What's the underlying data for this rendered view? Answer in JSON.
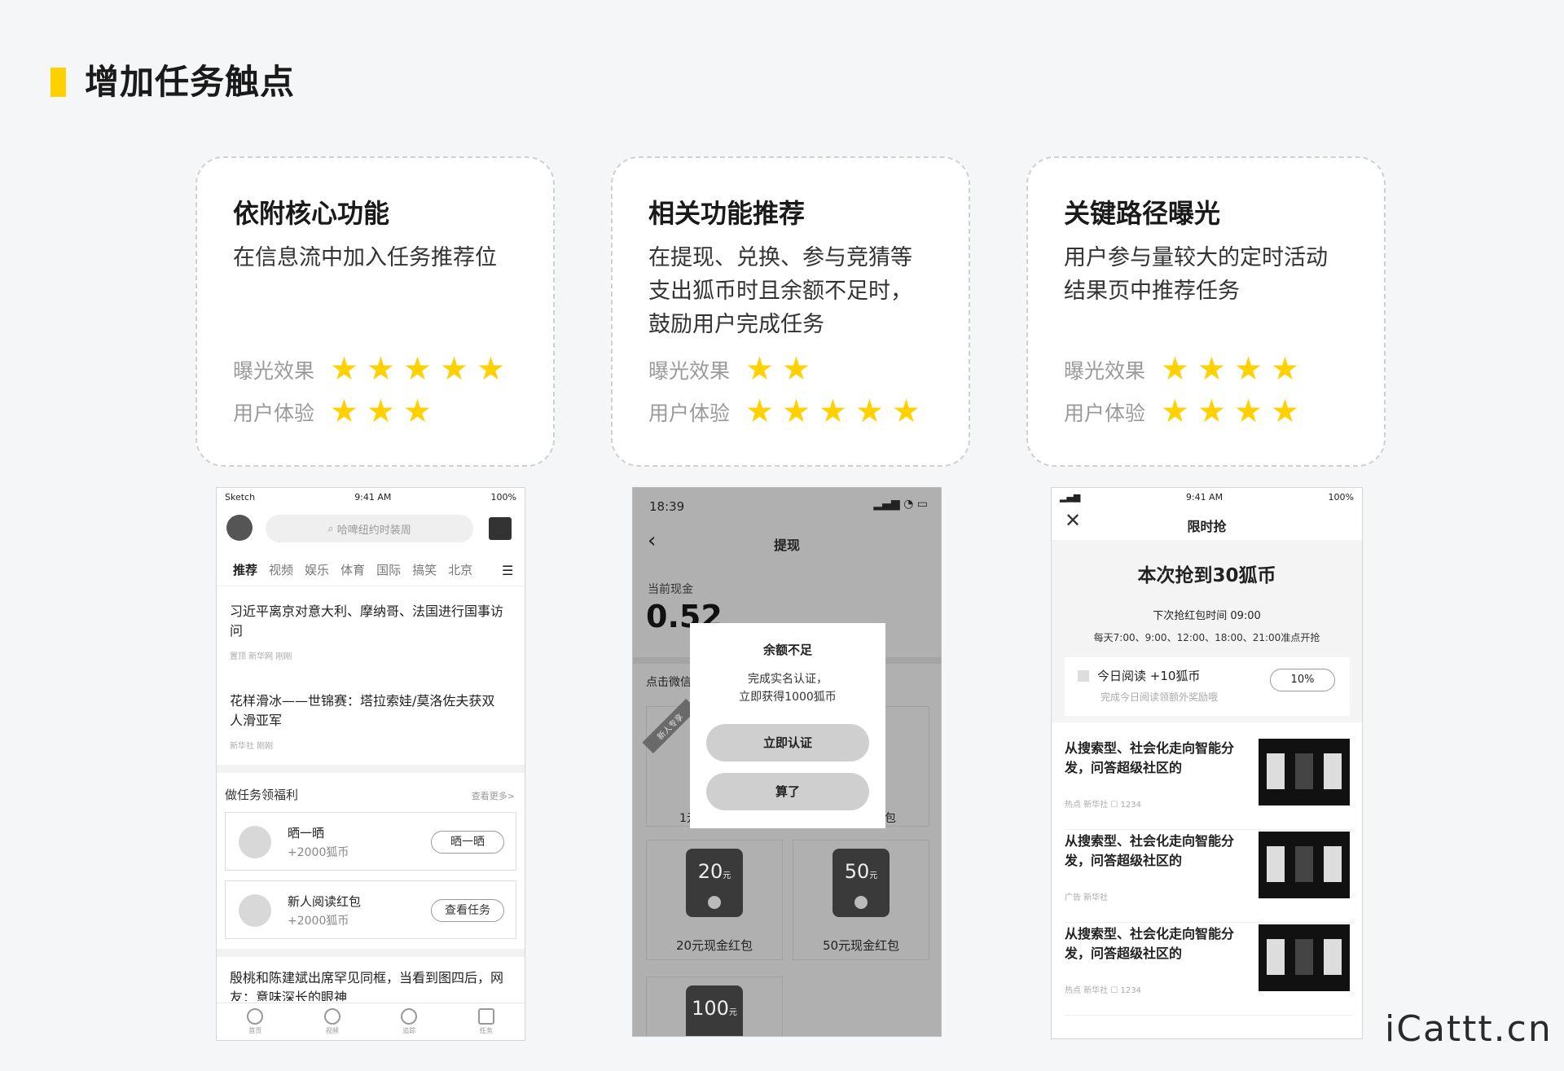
{
  "page": {
    "title": "增加任务触点",
    "watermark": "iCattt.cn"
  },
  "cards": [
    {
      "title": "依附核心功能",
      "desc": "在信息流中加入任务推荐位",
      "exposure_label": "曝光效果",
      "exposure_stars": 5,
      "ux_label": "用户体验",
      "ux_stars": 3
    },
    {
      "title": "相关功能推荐",
      "desc": "在提现、兑换、参与竞猜等\n支出狐币时且余额不足时，\n鼓励用户完成任务",
      "exposure_label": "曝光效果",
      "exposure_stars": 2,
      "ux_label": "用户体验",
      "ux_stars": 5
    },
    {
      "title": "关键路径曝光",
      "desc": "用户参与量较大的定时活动\n结果页中推荐任务",
      "exposure_label": "曝光效果",
      "exposure_stars": 4,
      "ux_label": "用户体验",
      "ux_stars": 4
    }
  ],
  "star_color": "#ffd100",
  "phone1": {
    "status": {
      "carrier": "Sketch",
      "time": "9:41 AM",
      "battery": "100%"
    },
    "search_placeholder": "哈啤纽约时装周",
    "nav": [
      "推荐",
      "视频",
      "娱乐",
      "体育",
      "国际",
      "搞笑",
      "北京"
    ],
    "news": [
      {
        "title": "习近平离京对意大利、摩纳哥、法国进行国事访问",
        "meta": "置顶  新华网  刚刚"
      },
      {
        "title": "花样滑冰——世锦赛：塔拉索娃/莫洛佐夫获双人滑亚军",
        "meta": "新华社  刚刚"
      }
    ],
    "task_section": {
      "title": "做任务领福利",
      "more": "查看更多>"
    },
    "tasks": [
      {
        "name": "晒一晒",
        "reward": "+2000狐币",
        "button": "晒一晒"
      },
      {
        "name": "新人阅读红包",
        "reward": "+2000狐币",
        "button": "查看任务"
      }
    ],
    "bottom_news": "殷桃和陈建斌出席罕见同框，当看到图四后，网友：意味深长的眼神",
    "tabs": [
      "首页",
      "视频",
      "追踪",
      "任务"
    ]
  },
  "phone2": {
    "status": {
      "time": "18:39"
    },
    "nav_title": "提现",
    "balance_label": "当前现金",
    "balance": "0.52",
    "section_label": "点击微信",
    "badge": "新人专享",
    "modal": {
      "title": "余额不足",
      "text1": "完成实名认证，",
      "text2": "立即获得1000狐币",
      "confirm": "立即认证",
      "cancel": "算了"
    },
    "left_partial": "1元",
    "right_partial": "包",
    "options": [
      {
        "amount": "20",
        "unit": "元",
        "label": "20元现金红包"
      },
      {
        "amount": "50",
        "unit": "元",
        "label": "50元现金红包"
      },
      {
        "amount": "100",
        "unit": "元"
      }
    ]
  },
  "phone3": {
    "status": {
      "time": "9:41 AM",
      "battery": "100%"
    },
    "nav_title": "限时抢",
    "headline": "本次抢到30狐币",
    "next_time": "下次抢红包时间 09:00",
    "schedule": "每天7:00、9:00、12:00、18:00、21:00准点开抢",
    "task": {
      "title": "今日阅读 +10狐币",
      "sub": "完成今日阅读领额外奖励哦",
      "progress": "10%"
    },
    "feed": [
      {
        "title": "从搜索型、社会化走向智能分发，问答超级社区的",
        "meta": "热点  新华社  ☐ 1234"
      },
      {
        "title": "从搜索型、社会化走向智能分发，问答超级社区的",
        "meta": "广告  新华社"
      },
      {
        "title": "从搜索型、社会化走向智能分发，问答超级社区的",
        "meta": "热点  新华社  ☐ 1234"
      }
    ]
  }
}
